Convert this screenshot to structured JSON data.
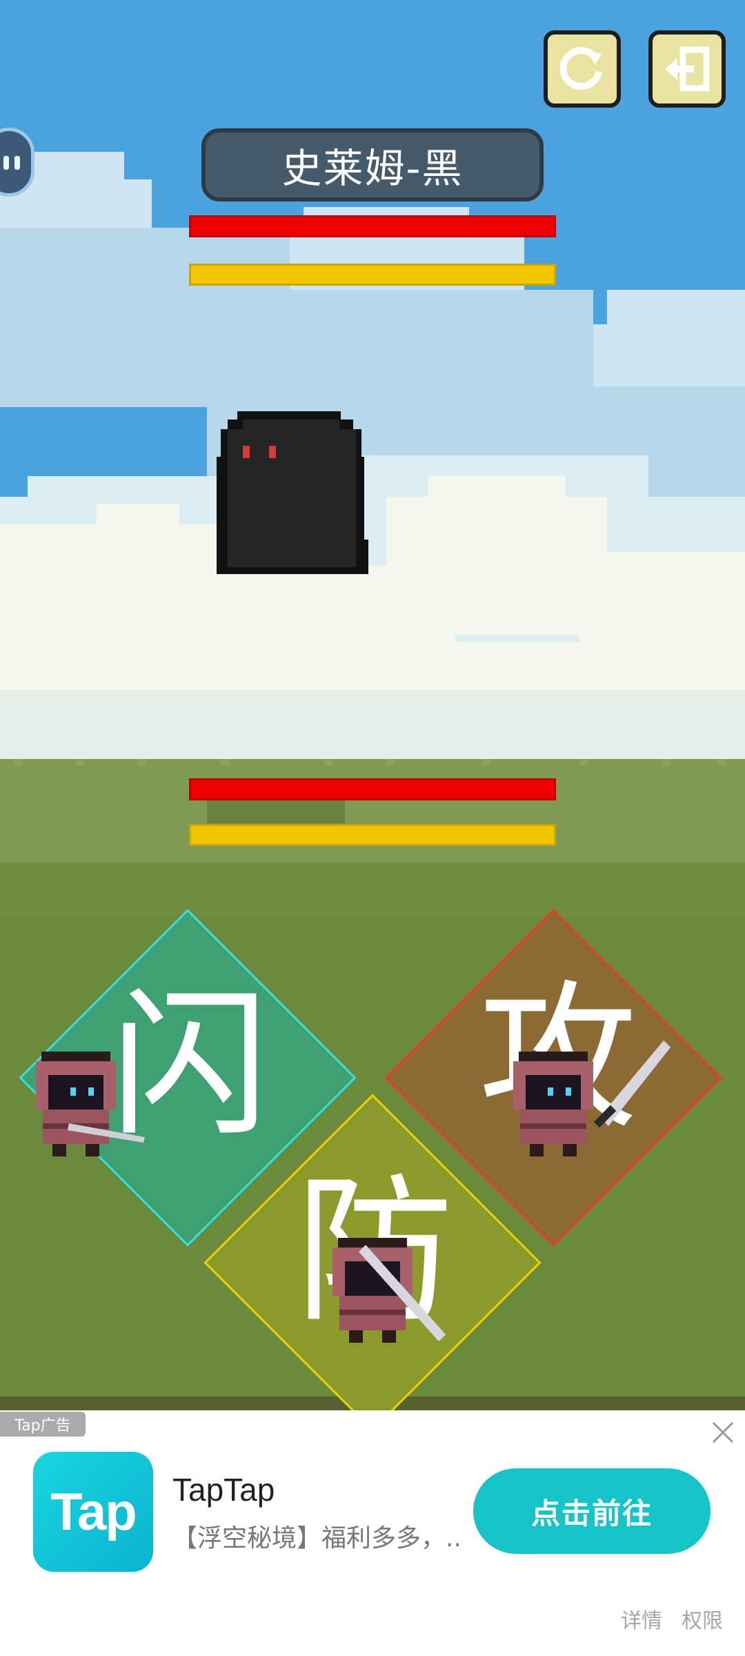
{
  "top_buttons": {
    "restart_icon": "restart-icon",
    "exit_icon": "exit-icon"
  },
  "enemy": {
    "name": "史莱姆-黑",
    "hp_fraction": 1.0,
    "energy_fraction": 1.0
  },
  "player": {
    "hp_fraction": 1.0,
    "energy_fraction": 1.0
  },
  "actions": {
    "dodge": {
      "label": "闪",
      "color": "#3fa072",
      "accent": "#2fe2e8"
    },
    "attack": {
      "label": "攻",
      "color": "#8b6b33",
      "accent": "#ee3a22"
    },
    "defend": {
      "label": "防",
      "color": "#8c9a2c",
      "accent": "#f0d000"
    }
  },
  "ad": {
    "tag": "Tap广告",
    "app_name": "TapTap",
    "logo_text": "Tap",
    "description": "【浮空秘境】福利多多，...",
    "cta_label": "点击前往",
    "details_label": "详情",
    "permissions_label": "权限"
  }
}
